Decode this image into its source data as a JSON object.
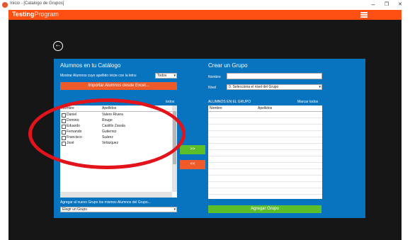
{
  "window": {
    "title": "Inicio - [Catalogo de Grupos]",
    "minimize": "–",
    "maximize": "❐",
    "close": "✕"
  },
  "header": {
    "brand_bold": "Testing",
    "brand_light": "Program",
    "menu_icon": "hamburger-icon",
    "accent": "#ff4f12"
  },
  "catalog": {
    "title": "Alumnos en tu Catálogo",
    "filter_label": "Mostrar Alumnos cuyo apellido inicie con la letra:",
    "filter_value": "Todos",
    "import_button": "Importar Alumnos desde Excel...",
    "mark_all": "todos",
    "columns": [
      "Nombre",
      "Apellidos"
    ],
    "rows": [
      {
        "nombre": "Daniel",
        "apellidos": "Valero Rivera"
      },
      {
        "nombre": "Dominic",
        "apellidos": "Rouge"
      },
      {
        "nombre": "Eduardo",
        "apellidos": "Castillo Zavala"
      },
      {
        "nombre": "Fernando",
        "apellidos": "Gutierrez"
      },
      {
        "nombre": "Francisco",
        "apellidos": "Suárez"
      },
      {
        "nombre": "José",
        "apellidos": "Velázquez"
      }
    ],
    "add_to_group_label": "Agregar al nuevo Grupo los mismos Alumnos del Grupo...",
    "group_select_value": "Elegir un Grupo"
  },
  "transfer": {
    "add": ">>",
    "remove": "<<"
  },
  "create": {
    "title": "Crear un Grupo",
    "name_label": "Nombre",
    "name_value": "",
    "level_label": "Nivel",
    "level_value": "0. Selecciona el nivel del Grupo",
    "members_label": "ALUMNOS EN EL GRUPO",
    "mark_all": "Marcar todos",
    "columns": [
      "Nombre",
      "Apellidos"
    ],
    "add_group_button": "Agregar Grupo"
  }
}
